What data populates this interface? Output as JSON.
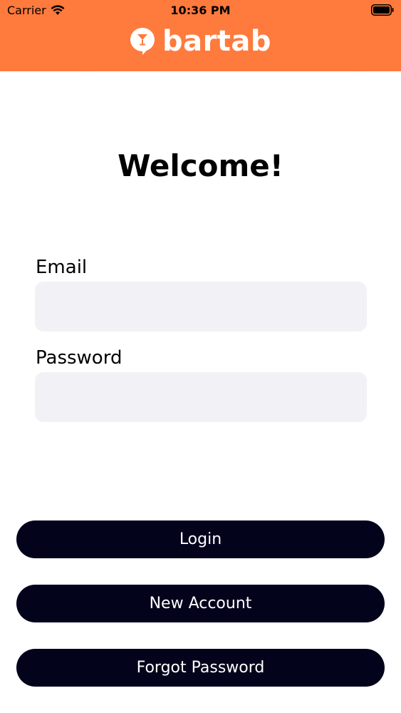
{
  "status_bar": {
    "carrier": "Carrier",
    "time": "10:36 PM"
  },
  "header": {
    "brand_name": "bartab",
    "color": "#FF7A3D"
  },
  "title": "Welcome!",
  "form": {
    "email_label": "Email",
    "email_value": "",
    "password_label": "Password",
    "password_value": ""
  },
  "buttons": {
    "login": "Login",
    "new_account": "New Account",
    "forgot_password": "Forgot Password",
    "color": "#03041C"
  }
}
